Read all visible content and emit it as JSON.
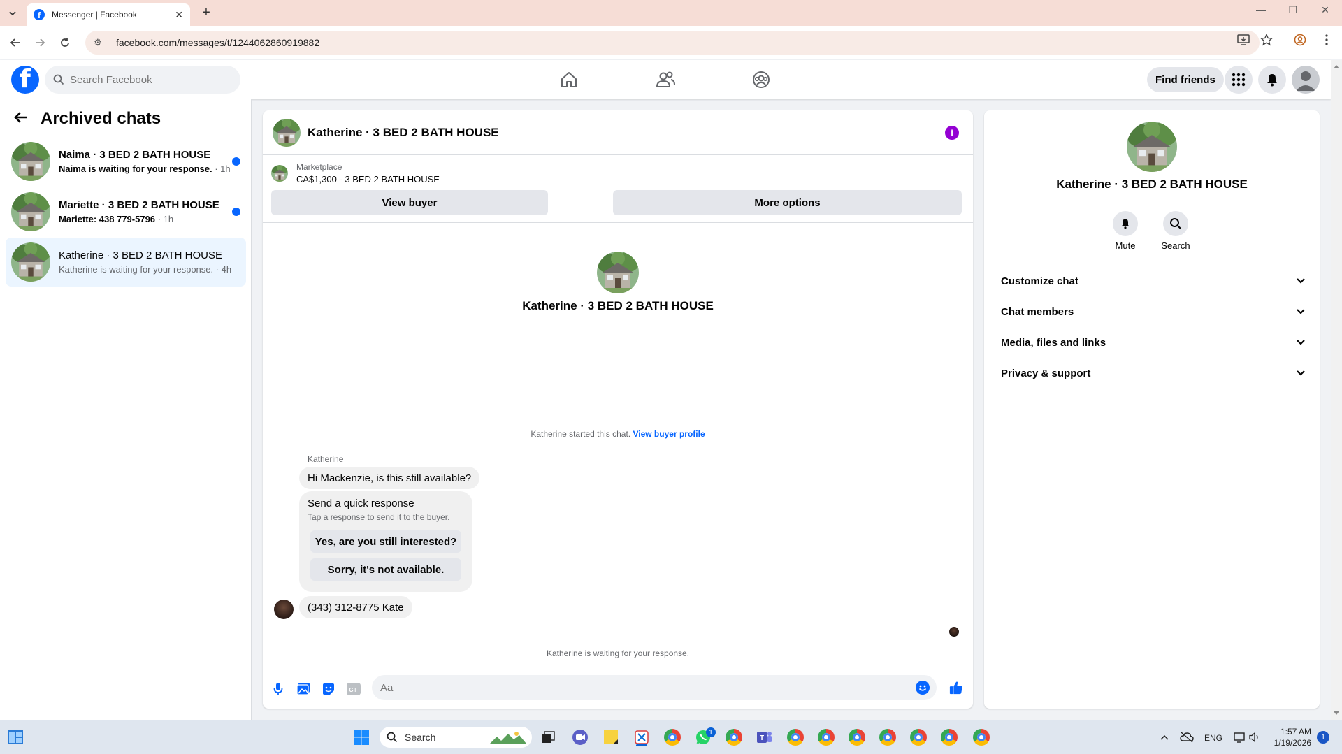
{
  "browser": {
    "tab_title": "Messenger | Facebook",
    "url": "facebook.com/messages/t/1244062860919882"
  },
  "fb": {
    "search_placeholder": "Search Facebook",
    "find_friends": "Find friends"
  },
  "archived": {
    "title": "Archived chats",
    "chats": [
      {
        "name": "Naima · 3 BED 2 BATH HOUSE",
        "preview": "Naima is waiting for your response.",
        "time": " · 1h",
        "unread": true
      },
      {
        "name": "Mariette · 3 BED 2 BATH HOUSE",
        "preview": "Mariette: 438 779-5796",
        "time": " · 1h",
        "unread": true
      },
      {
        "name": "Katherine · 3 BED 2 BATH HOUSE",
        "preview": "Katherine is waiting for your response.",
        "time": " · 4h",
        "unread": false
      }
    ]
  },
  "conversation": {
    "title": "Katherine · 3 BED 2 BATH HOUSE",
    "marketplace_label": "Marketplace",
    "listing": "CA$1,300 - 3 BED 2 BATH HOUSE",
    "view_buyer": "View buyer",
    "more_options": "More options",
    "center_name": "Katherine · 3 BED 2 BATH HOUSE",
    "started_text": "Katherine started this chat.",
    "view_buyer_profile": "View buyer profile",
    "sender": "Katherine",
    "message1": "Hi Mackenzie, is this still available?",
    "quick_response_title": "Send a quick response",
    "quick_response_sub": "Tap a response to send it to the buyer.",
    "quick_response_1": "Yes, are you still interested?",
    "quick_response_2": "Sorry, it's not available.",
    "message2": "(343) 312-8775 Kate",
    "waiting": "Katherine is waiting for your response.",
    "composer_placeholder": "Aa"
  },
  "details": {
    "name": "Katherine · 3 BED 2 BATH HOUSE",
    "mute": "Mute",
    "search": "Search",
    "sections": [
      "Customize chat",
      "Chat members",
      "Media, files and links",
      "Privacy & support"
    ]
  },
  "taskbar": {
    "search": "Search",
    "lang": "ENG",
    "time": "1:57 AM",
    "date": "1/19/2026",
    "notifications": "1",
    "whatsapp_badge": "1"
  },
  "colors": {
    "fb_blue": "#0866ff",
    "info_purple": "#9400d3",
    "active_chat_bg": "#ebf5ff"
  }
}
